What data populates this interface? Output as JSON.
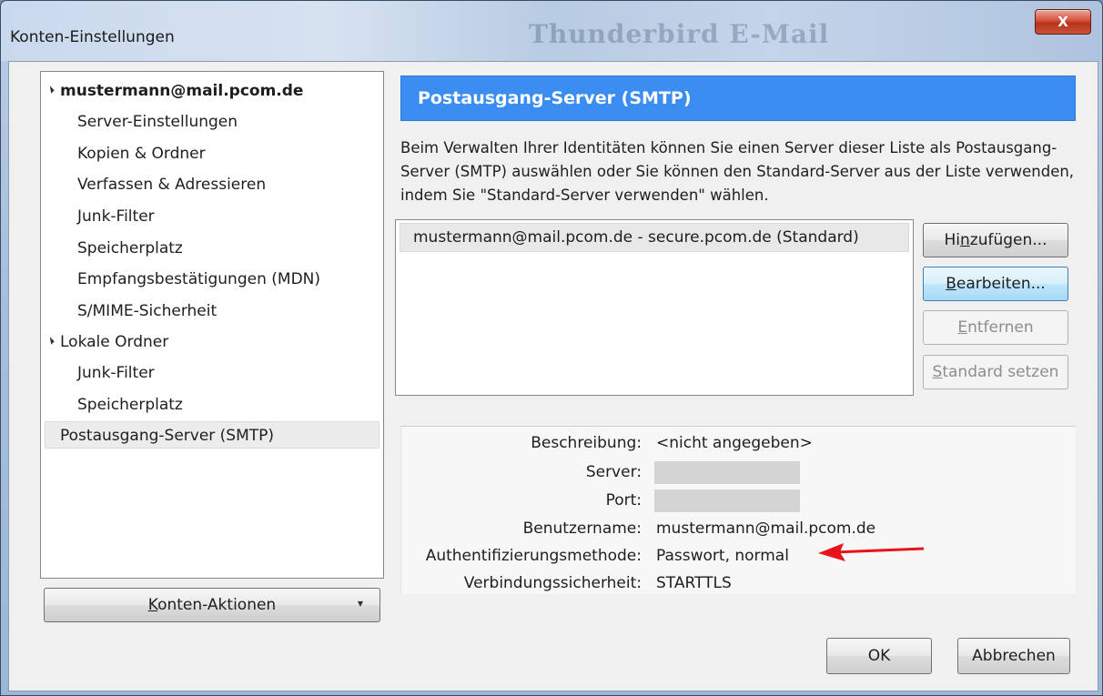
{
  "window": {
    "title": "Konten-Einstellungen",
    "background_text": "Thunderbird E-Mail",
    "close_label": "X"
  },
  "tree": {
    "items": [
      {
        "label": "mustermann@mail.pcom.de",
        "level": 0,
        "expanded": true,
        "bold": true
      },
      {
        "label": "Server-Einstellungen",
        "level": 1
      },
      {
        "label": "Kopien & Ordner",
        "level": 1
      },
      {
        "label": "Verfassen & Adressieren",
        "level": 1
      },
      {
        "label": "Junk-Filter",
        "level": 1
      },
      {
        "label": "Speicherplatz",
        "level": 1
      },
      {
        "label": "Empfangsbestätigungen (MDN)",
        "level": 1
      },
      {
        "label": "S/MIME-Sicherheit",
        "level": 1
      },
      {
        "label": "Lokale Ordner",
        "level": 0,
        "expanded": true
      },
      {
        "label": "Junk-Filter",
        "level": 1
      },
      {
        "label": "Speicherplatz",
        "level": 1
      },
      {
        "label": "Postausgang-Server (SMTP)",
        "level": 0,
        "selected": true
      }
    ]
  },
  "account_actions": {
    "label": "Konten-Aktionen",
    "mnemonic": "K",
    "rest": "onten-Aktionen"
  },
  "panel": {
    "title": "Postausgang-Server (SMTP)",
    "description": "Beim Verwalten Ihrer Identitäten können Sie einen Server dieser Liste als Postausgang-Server (SMTP) auswählen oder Sie können den Standard-Server aus der Liste verwenden, indem Sie \"Standard-Server verwenden\" wählen.",
    "servers": [
      "mustermann@mail.pcom.de - secure.pcom.de (Standard)"
    ]
  },
  "buttons": {
    "add": {
      "pre": "Hi",
      "mnemonic": "n",
      "post": "zufügen..."
    },
    "edit": {
      "pre": "",
      "mnemonic": "B",
      "post": "earbeiten..."
    },
    "remove": {
      "pre": "",
      "mnemonic": "E",
      "post": "ntfernen"
    },
    "set_default": {
      "pre": "",
      "mnemonic": "S",
      "post": "tandard setzen"
    },
    "ok": "OK",
    "cancel": "Abbrechen"
  },
  "details": {
    "description_label": "Beschreibung:",
    "description_value": "<nicht angegeben>",
    "server_label": "Server:",
    "port_label": "Port:",
    "username_label": "Benutzername:",
    "username_value": "mustermann@mail.pcom.de",
    "auth_label": "Authentifizierungsmethode:",
    "auth_value": "Passwort, normal",
    "security_label": "Verbindungssicherheit:",
    "security_value": "STARTTLS"
  },
  "colors": {
    "header_bg": "#3b8df1",
    "annotation_arrow": "#e8141b"
  }
}
